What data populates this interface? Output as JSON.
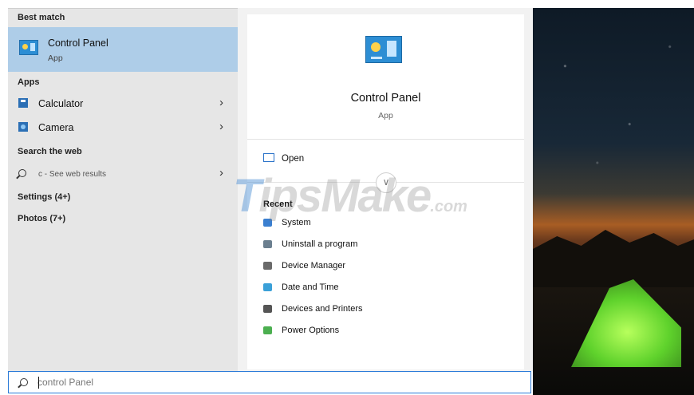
{
  "left_pane": {
    "best_match_heading": "Best match",
    "best_match": {
      "title": "Control Panel",
      "subtitle": "App",
      "icon": "control-panel-icon"
    },
    "apps_heading": "Apps",
    "apps": [
      {
        "label": "Calculator",
        "icon": "calculator-icon"
      },
      {
        "label": "Camera",
        "icon": "camera-icon"
      }
    ],
    "search_web_heading": "Search the web",
    "web_result": {
      "label": "c - See web results",
      "icon": "search-icon"
    },
    "settings": "Settings (4+)",
    "photos": "Photos (7+)"
  },
  "detail_pane": {
    "title": "Control Panel",
    "subtitle": "App",
    "open_label": "Open",
    "recent_heading": "Recent",
    "recent_items": [
      {
        "label": "System",
        "icon": "system-icon",
        "color": "#3a7fd0"
      },
      {
        "label": "Uninstall a program",
        "icon": "programs-icon",
        "color": "#6b7f8f"
      },
      {
        "label": "Device Manager",
        "icon": "device-manager-icon",
        "color": "#6a6a6a"
      },
      {
        "label": "Date and Time",
        "icon": "clock-icon",
        "color": "#3aa0d8"
      },
      {
        "label": "Devices and Printers",
        "icon": "printer-icon",
        "color": "#555555"
      },
      {
        "label": "Power Options",
        "icon": "power-icon",
        "color": "#4caf50"
      }
    ]
  },
  "watermark": {
    "left": "T",
    "main": "ipsMake",
    "suffix": ".com"
  },
  "search": {
    "query": "control Panel"
  }
}
